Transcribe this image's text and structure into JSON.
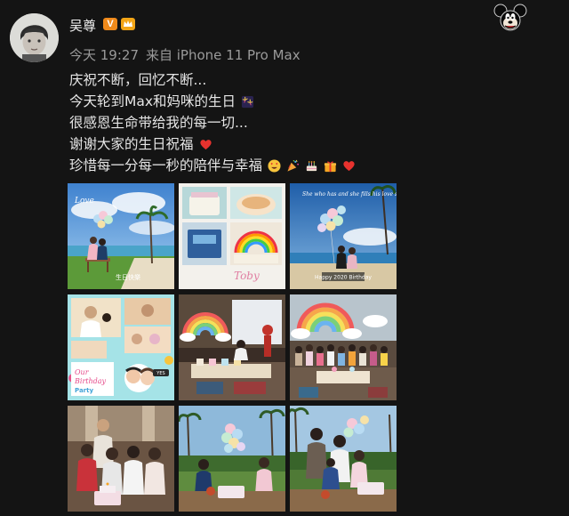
{
  "post": {
    "username": "吴尊",
    "verified_badge": "V",
    "time": "今天 19:27",
    "source": "来自 iPhone 11 Pro Max",
    "lines": [
      "庆祝不断，回忆不断...",
      "今天轮到Max和妈咪的生日",
      "很感恩生命带给我的每一切...",
      "谢谢大家的生日祝福",
      "珍惜每一分每一秒的陪伴与幸福"
    ]
  },
  "photos": [
    {
      "caption": "Happy 2020 Birthday",
      "scene": "beach-couple"
    },
    {
      "caption": "Toby",
      "scene": "cake-collage"
    },
    {
      "caption": "Happy 2020 Birthday",
      "scene": "beach-balloons"
    },
    {
      "caption": "Birthday Party",
      "scene": "party-collage"
    },
    {
      "caption": "",
      "scene": "rainbow-party"
    },
    {
      "caption": "",
      "scene": "rainbow-group"
    },
    {
      "caption": "",
      "scene": "family-cake"
    },
    {
      "caption": "",
      "scene": "resort-balloons"
    },
    {
      "caption": "",
      "scene": "resort-family"
    }
  ],
  "colors": {
    "background": "#141414",
    "accent_badge": "#f08a1b",
    "meta_text": "#9a9a9a"
  }
}
